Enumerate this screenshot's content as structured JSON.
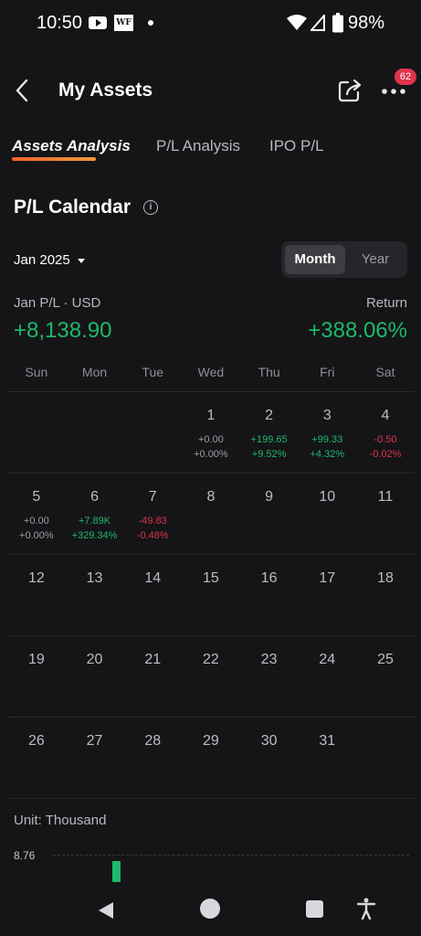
{
  "status_bar": {
    "time": "10:50",
    "wf_label": "WF",
    "battery": "98%"
  },
  "header": {
    "title": "My Assets",
    "notification_count": "62"
  },
  "tabs": [
    {
      "label": "Assets Analysis",
      "active": true
    },
    {
      "label": "P/L Analysis",
      "active": false
    },
    {
      "label": "IPO P/L",
      "active": false
    }
  ],
  "calendar": {
    "title": "P/L Calendar",
    "info_glyph": "i",
    "month": "Jan 2025",
    "view_options": [
      "Month",
      "Year"
    ],
    "selected_view": "Month",
    "pl_label": "Jan P/L · USD",
    "pl_value": "+8,138.90",
    "return_label": "Return",
    "return_value": "+388.06%",
    "weekdays": [
      "Sun",
      "Mon",
      "Tue",
      "Wed",
      "Thu",
      "Fri",
      "Sat"
    ],
    "weeks": [
      [
        {
          "day": ""
        },
        {
          "day": ""
        },
        {
          "day": ""
        },
        {
          "day": "1",
          "pl": "+0.00",
          "ret": "+0.00%",
          "tone": "neu"
        },
        {
          "day": "2",
          "pl": "+199.65",
          "ret": "+9.52%",
          "tone": "pos"
        },
        {
          "day": "3",
          "pl": "+99.33",
          "ret": "+4.32%",
          "tone": "pos"
        },
        {
          "day": "4",
          "pl": "-0.50",
          "ret": "-0.02%",
          "tone": "neg"
        }
      ],
      [
        {
          "day": "5",
          "pl": "+0.00",
          "ret": "+0.00%",
          "tone": "neu"
        },
        {
          "day": "6",
          "pl": "+7.89K",
          "ret": "+329.34%",
          "tone": "pos"
        },
        {
          "day": "7",
          "pl": "-49.83",
          "ret": "-0.48%",
          "tone": "neg"
        },
        {
          "day": "8"
        },
        {
          "day": "9"
        },
        {
          "day": "10"
        },
        {
          "day": "11"
        }
      ],
      [
        {
          "day": "12"
        },
        {
          "day": "13"
        },
        {
          "day": "14"
        },
        {
          "day": "15"
        },
        {
          "day": "16"
        },
        {
          "day": "17"
        },
        {
          "day": "18"
        }
      ],
      [
        {
          "day": "19"
        },
        {
          "day": "20"
        },
        {
          "day": "21"
        },
        {
          "day": "22"
        },
        {
          "day": "23"
        },
        {
          "day": "24"
        },
        {
          "day": "25"
        }
      ],
      [
        {
          "day": "26"
        },
        {
          "day": "27"
        },
        {
          "day": "28"
        },
        {
          "day": "29"
        },
        {
          "day": "30"
        },
        {
          "day": "31"
        },
        {
          "day": ""
        }
      ]
    ]
  },
  "chart": {
    "unit_label": "Unit: Thousand",
    "axis_max": "8.76"
  },
  "colors": {
    "positive": "#1db96a",
    "negative": "#e0344a",
    "accent": "#f0652a",
    "background": "#151518"
  }
}
